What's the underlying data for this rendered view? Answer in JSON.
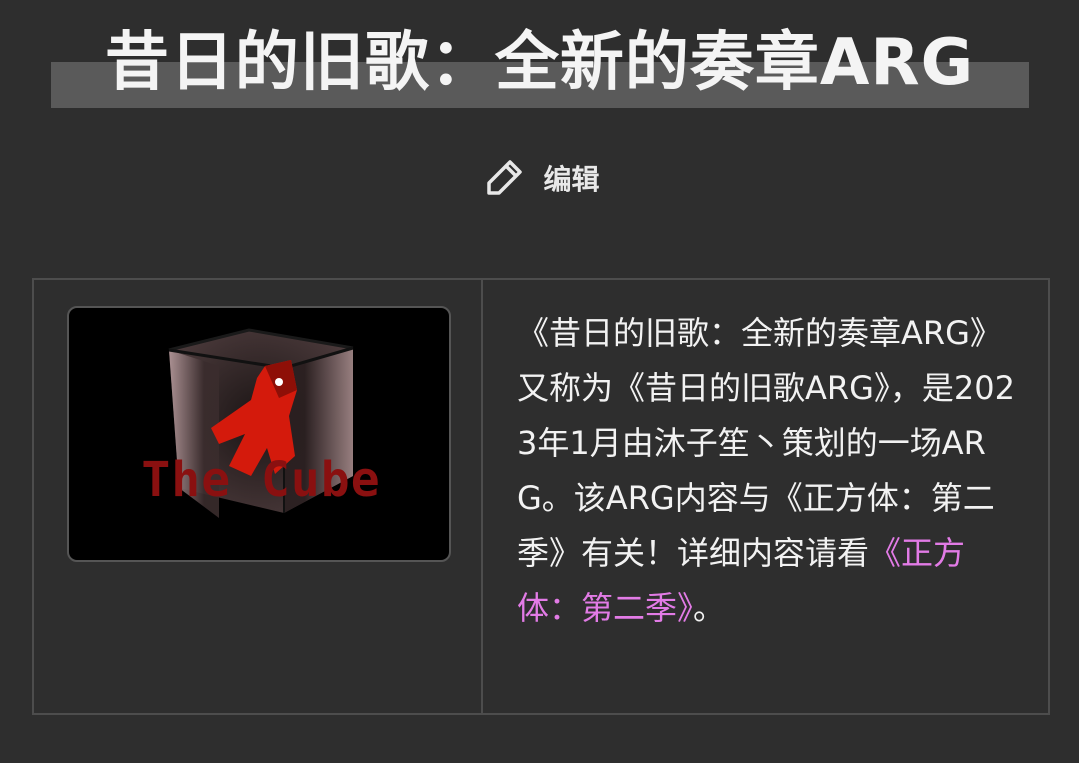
{
  "page": {
    "title": "昔日的旧歌：全新的奏章ARG"
  },
  "edit": {
    "label": "编辑",
    "icon": "pencil-icon"
  },
  "infobox": {
    "image": {
      "caption_text": "The Cube",
      "icon": "cube-figure-image"
    },
    "description": {
      "text_before_link": "《昔日的旧歌：全新的奏章ARG》又称为《昔日的旧歌ARG》，是2023年1月由沐子笙丶策划的一场ARG。该ARG内容与《正方体：第二季》有关！详细内容请看",
      "link_text": "《正方体：第二季》",
      "text_after_link": "。"
    }
  },
  "colors": {
    "background": "#2e2e2e",
    "title_band": "#5a5a5a",
    "link": "#e27be6",
    "border": "#4d4d4d",
    "logo_text": "#8a1010",
    "figure": "#d41a0c"
  }
}
